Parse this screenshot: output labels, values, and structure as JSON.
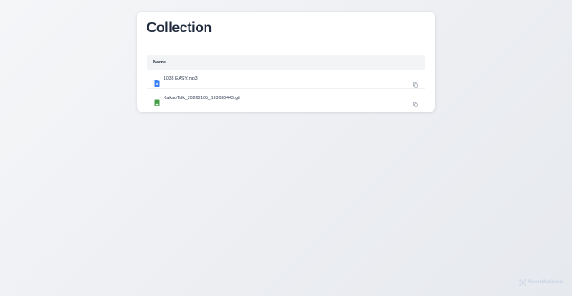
{
  "page": {
    "title": "Collection"
  },
  "table": {
    "header_name": "Name",
    "rows": [
      {
        "name": "1038 EASY.mp3",
        "icon": "audio-file-icon",
        "icon_color": "#3b82f6"
      },
      {
        "name": "KakaoTalk_20260105_193020443.gif",
        "icon": "image-file-icon",
        "icon_color": "#43a047"
      }
    ]
  },
  "watermark": {
    "text": "ScanMalware"
  },
  "colors": {
    "title": "#1f2a3d",
    "header_bg": "#f3f4f6",
    "audio_icon": "#3b82f6",
    "image_icon": "#43a047",
    "watermark": "#c9d3e3"
  }
}
